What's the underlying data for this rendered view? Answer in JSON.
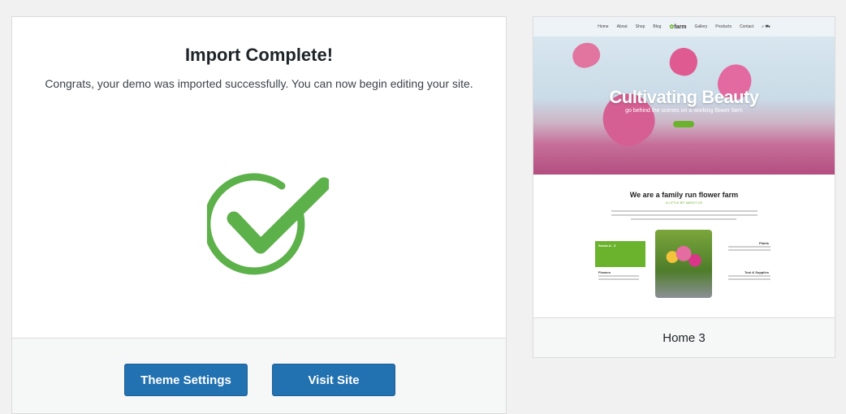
{
  "import": {
    "title": "Import Complete!",
    "message": "Congrats, your demo was imported successfully. You can now begin editing your site.",
    "status_icon": "check-circle-icon",
    "accent_color": "#5db14a"
  },
  "actions": {
    "theme_settings_label": "Theme Settings",
    "visit_site_label": "Visit Site",
    "button_color": "#2271b1"
  },
  "preview": {
    "label": "Home 3",
    "thumbnail": {
      "nav_items": [
        "Home",
        "About",
        "Shop",
        "Blog",
        "Gallery",
        "Products",
        "Contact"
      ],
      "logo_text": "farm",
      "hero_title": "Cultivating Beauty",
      "hero_subtitle": "go behind the scenes on a working flower farm",
      "section_title": "We are a family run flower farm",
      "section_subtitle": "A LITTLE BIT ABOUT US",
      "features": [
        "Seeds A - Z",
        "Flowers",
        "Plants",
        "Tool & Supplies"
      ]
    }
  }
}
